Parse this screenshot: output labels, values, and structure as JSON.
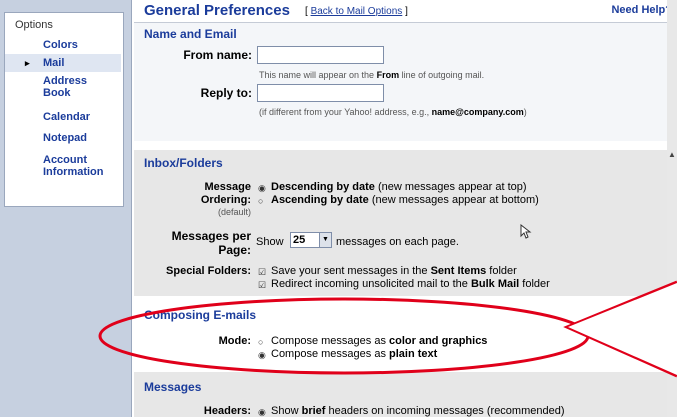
{
  "nav": {
    "header": "Options",
    "items": [
      "Colors",
      "Mail",
      "Address Book",
      "Calendar",
      "Notepad",
      "Account Information"
    ],
    "selected_marker": "▸"
  },
  "header": {
    "title": "General Preferences",
    "back_link_prefix": "[",
    "back_link": "Back to Mail Options",
    "back_link_suffix": "]",
    "help": "Need Help?"
  },
  "name_email": {
    "heading": "Name and Email",
    "from_label": "From name:",
    "from_value": "",
    "from_hint_pre": "This name will appear on the",
    "from_hint_bold": "From",
    "from_hint_post": "line of outgoing mail.",
    "reply_label": "Reply to:",
    "reply_value": "",
    "reply_hint_pre": "(if different from your Yahoo! address, e.g.,",
    "reply_hint_bold": "name@company.com",
    "reply_hint_post": ")"
  },
  "inbox": {
    "heading": "Inbox/Folders",
    "ordering_label_1": "Message",
    "ordering_label_2": "Ordering:",
    "ordering_default": "(default)",
    "opt_desc_bold": "Descending by date",
    "opt_desc_rest": "(new messages appear at top)",
    "opt_asc_bold": "Ascending by date",
    "opt_asc_rest": "(new messages appear at bottom)",
    "perpage_label_1": "Messages per",
    "perpage_label_2": "Page:",
    "show_pre": "Show",
    "show_value": "25",
    "show_post": "messages on each page.",
    "special_label": "Special Folders:",
    "sent_pre": "Save your sent messages in the",
    "sent_bold": "Sent Items",
    "sent_post": "folder",
    "bulk_pre": "Redirect incoming unsolicited mail to the",
    "bulk_bold": "Bulk Mail",
    "bulk_post": "folder"
  },
  "composing": {
    "heading": "Composing E-mails",
    "mode_label": "Mode:",
    "opt_color_pre": "Compose messages as",
    "opt_color_bold": "color and graphics",
    "opt_plain_pre": "Compose messages as",
    "opt_plain_bold": "plain text"
  },
  "messages": {
    "heading": "Messages",
    "headers_label": "Headers:",
    "opt_brief_pre": "Show",
    "opt_brief_bold": "brief",
    "opt_brief_post": "headers on incoming messages (recommended)"
  },
  "colors": {
    "link": "#1b3c9b",
    "annotation_red": "#e0001a",
    "section_gray": "#e7e7e7"
  }
}
